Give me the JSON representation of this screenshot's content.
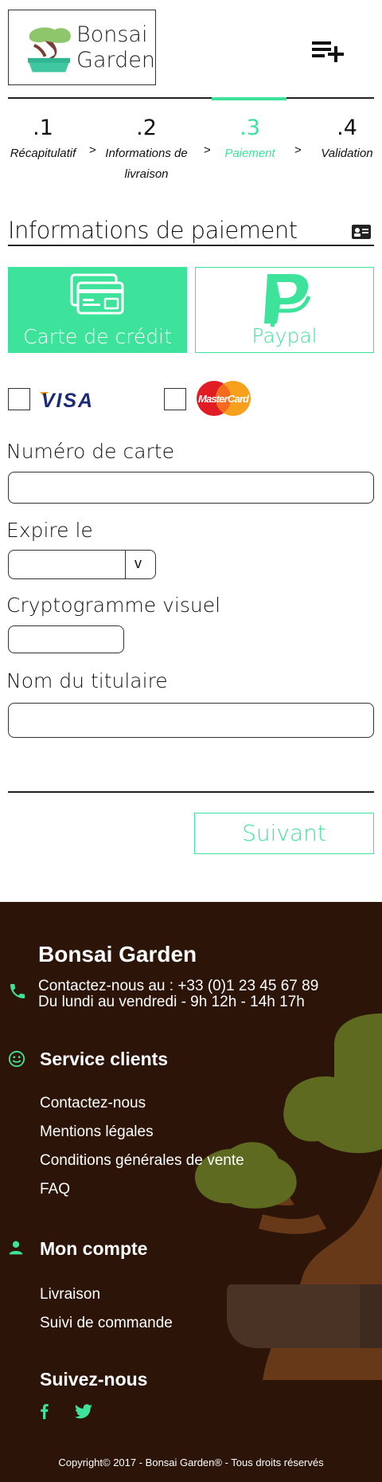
{
  "header": {
    "logo_line1": "Bonsai",
    "logo_line2": "Garden",
    "menu_icon": "add-to-list-icon"
  },
  "steps": [
    {
      "num": ".1",
      "label": "Récapitulatif",
      "active": false
    },
    {
      "num": ".2",
      "label": "Informations de livraison",
      "active": false
    },
    {
      "num": ".3",
      "label": "Paiement",
      "active": true
    },
    {
      "num": ".4",
      "label": "Validation",
      "active": false
    }
  ],
  "steps_separator": ">",
  "payment": {
    "title": "Informations de paiement",
    "title_icon": "id-card-icon",
    "methods": [
      {
        "label": "Carte de crédit",
        "icon": "credit-card-icon",
        "selected": true
      },
      {
        "label": "Paypal",
        "icon": "paypal-icon",
        "selected": false
      }
    ],
    "card_brands": [
      {
        "name": "VISA",
        "checked": false
      },
      {
        "name": "MasterCard",
        "checked": false
      }
    ]
  },
  "form": {
    "card_number_label": "Numéro de carte",
    "card_number_value": "",
    "expiry_label": "Expire le",
    "expiry_value": "",
    "expiry_arrow": "v",
    "cvv_label": "Cryptogramme visuel",
    "cvv_value": "",
    "holder_label": "Nom du titulaire",
    "holder_value": "",
    "next_label": "Suivant"
  },
  "footer": {
    "brand": "Bonsai Garden",
    "contact_line1": "Contactez-nous au : +33 (0)1 23 45 67 89",
    "contact_line2": "Du lundi au vendredi - 9h 12h - 14h 17h",
    "service_title": "Service clients",
    "service_links": [
      "Contactez-nous",
      "Mentions légales",
      "Conditions générales de vente",
      "FAQ"
    ],
    "account_title": "Mon compte",
    "account_links": [
      "Livraison",
      "Suivi de commande"
    ],
    "follow_title": "Suivez-nous",
    "social_icons": [
      "facebook-icon",
      "twitter-icon"
    ],
    "copyright": "Copyright© 2017 - Bonsai Garden® - Tous droits réservés"
  },
  "colors": {
    "accent": "#3ee39b",
    "footer_bg": "#2c1408",
    "text": "#111111"
  }
}
